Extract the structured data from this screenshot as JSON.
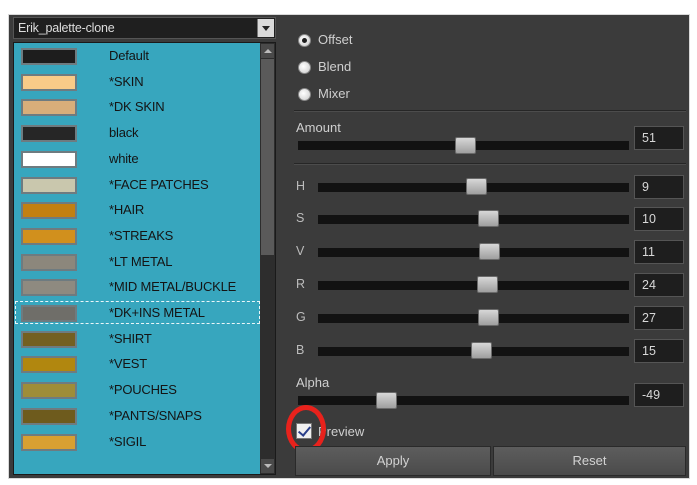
{
  "palette_dropdown": {
    "value": "Erik_palette-clone"
  },
  "colors": [
    {
      "name": "Default",
      "swatch": "#1d1d1d"
    },
    {
      "name": "*SKIN",
      "swatch": "#f9cb88"
    },
    {
      "name": "*DK SKIN",
      "swatch": "#d8ae7a"
    },
    {
      "name": "black",
      "swatch": "#262626"
    },
    {
      "name": "white",
      "swatch": "#ffffff"
    },
    {
      "name": "*FACE PATCHES",
      "swatch": "#c9c7ad"
    },
    {
      "name": "*HAIR",
      "swatch": "#c28012"
    },
    {
      "name": "*STREAKS",
      "swatch": "#d1901d"
    },
    {
      "name": "*LT METAL",
      "swatch": "#8c877c"
    },
    {
      "name": "*MID METAL/BUCKLE",
      "swatch": "#8e8a80"
    },
    {
      "name": "*DK+INS METAL",
      "swatch": "#6f6e69"
    },
    {
      "name": "*SHIRT",
      "swatch": "#736021"
    },
    {
      "name": "*VEST",
      "swatch": "#b1870f"
    },
    {
      "name": "*POUCHES",
      "swatch": "#9e8d38"
    },
    {
      "name": "*PANTS/SNAPS",
      "swatch": "#6e5b1d"
    },
    {
      "name": "*SIGIL",
      "swatch": "#d8a032"
    }
  ],
  "selected_color_index": 10,
  "modes": [
    {
      "label": "Offset",
      "checked": true
    },
    {
      "label": "Blend",
      "checked": false
    },
    {
      "label": "Mixer",
      "checked": false
    }
  ],
  "amount": {
    "label": "Amount",
    "value": "51"
  },
  "channels": [
    {
      "letter": "H",
      "value": "9"
    },
    {
      "letter": "S",
      "value": "10"
    },
    {
      "letter": "V",
      "value": "11"
    },
    {
      "letter": "R",
      "value": "24"
    },
    {
      "letter": "G",
      "value": "27"
    },
    {
      "letter": "B",
      "value": "15"
    }
  ],
  "alpha": {
    "label": "Alpha",
    "value": "-49"
  },
  "preview": {
    "label": "Preview",
    "checked": true
  },
  "buttons": {
    "apply": "Apply",
    "reset": "Reset"
  },
  "colors_theme": {
    "list_bg": "#37a6be",
    "panel_bg": "#3b3b3b",
    "highlight": "#e8221c"
  }
}
